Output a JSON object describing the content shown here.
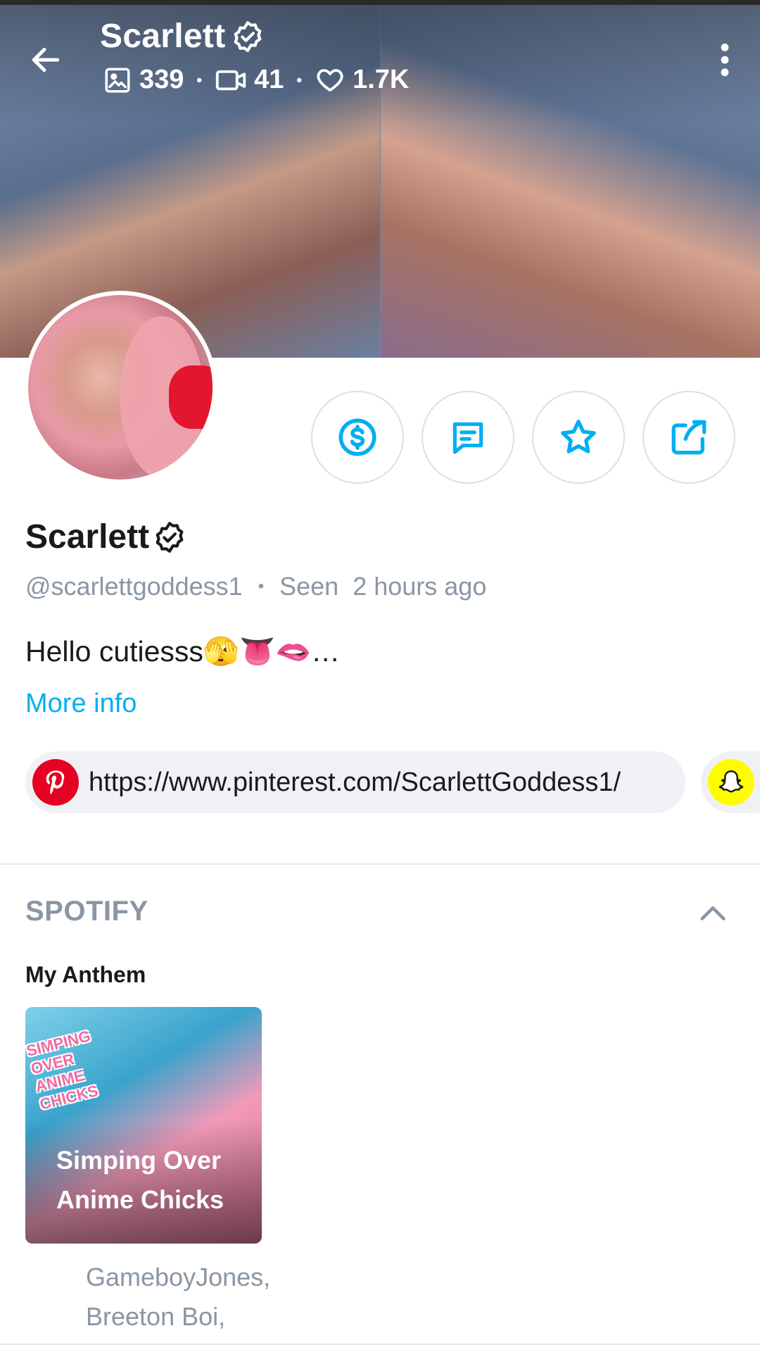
{
  "header": {
    "name": "Scarlett",
    "stats": {
      "photos": "339",
      "videos": "41",
      "likes": "1.7K"
    }
  },
  "profile": {
    "name": "Scarlett",
    "handle": "@scarlettgoddess1",
    "seen_label": "Seen",
    "seen_time": "2 hours ago",
    "bio": "Hello cutiesss🫣👅🫦…",
    "more_info": "More info"
  },
  "links": {
    "pinterest_url": "https://www.pinterest.com/ScarlettGoddess1/"
  },
  "spotify": {
    "section_title": "SPOTIFY",
    "anthem_label": "My Anthem",
    "album_title": "Simping Over Anime Chicks",
    "album_art_text": "SIMPING OVER ANIME CHICKS",
    "artists": [
      "GameboyJones,",
      "Breeton Boi,"
    ]
  },
  "icons": {
    "back": "arrow-left-icon",
    "menu": "more-vertical-icon",
    "verified": "verified-badge-icon",
    "photos": "image-icon",
    "videos": "video-icon",
    "likes": "heart-icon",
    "tip": "dollar-circle-icon",
    "message": "message-icon",
    "favorite": "star-icon",
    "share": "share-icon",
    "pinterest": "pinterest-icon",
    "snapchat": "snapchat-icon",
    "collapse": "chevron-up-icon"
  },
  "colors": {
    "accent": "#00aff0",
    "muted_text": "#8a96a3",
    "pinterest": "#e60023",
    "snapchat": "#fffc00"
  }
}
